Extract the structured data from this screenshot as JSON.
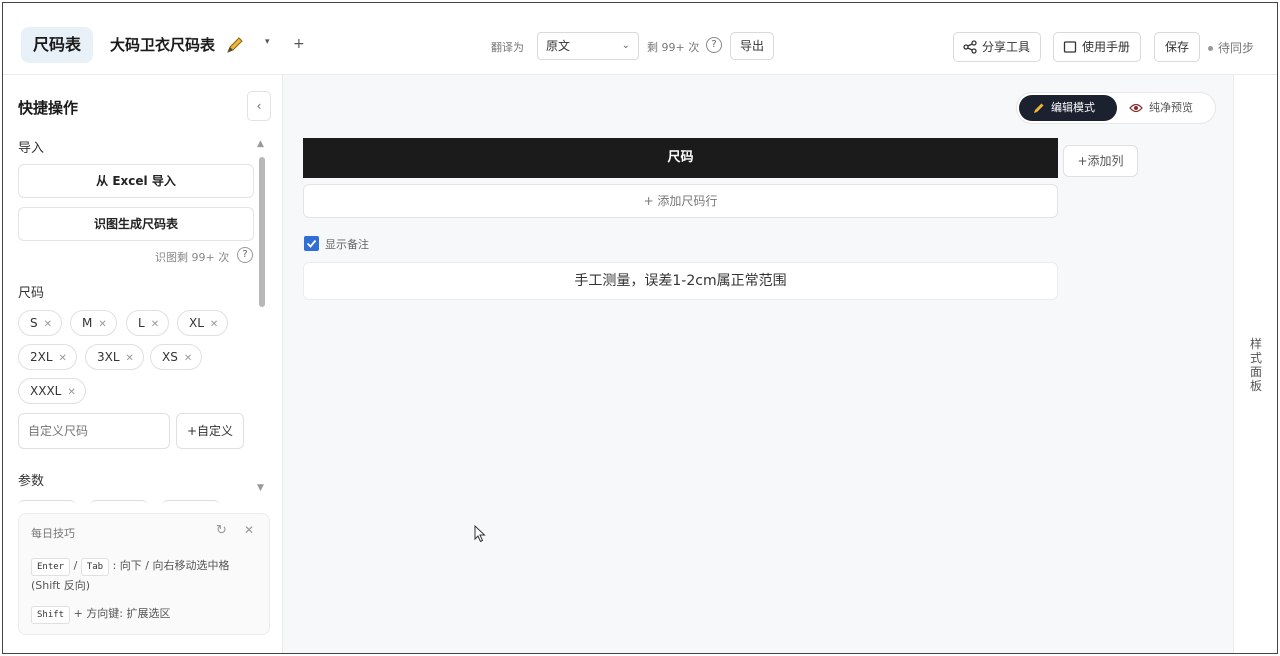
{
  "app": {
    "logo_label": "尺码表",
    "document_title": "大码卫衣尺码表"
  },
  "toolbar": {
    "translate_label": "翻译为",
    "translate_value": "原文",
    "remaining_label": "剩 99+ 次",
    "help_symbol": "?",
    "export_label": "导出",
    "share_label": "分享工具",
    "manual_label": "使用手册",
    "save_label": "保存",
    "sync_status": "待同步",
    "add_tab_symbol": "+",
    "dropdown_symbol": "▾"
  },
  "sidebar": {
    "title": "快捷操作",
    "collapse_symbol": "‹",
    "import_section": "导入",
    "import_excel": "从 Excel 导入",
    "recognize_image": "识图生成尺码表",
    "recognize_remaining": "识图剩 99+ 次",
    "size_section": "尺码",
    "sizes": [
      "S",
      "M",
      "L",
      "XL",
      "2XL",
      "3XL",
      "XS",
      "XXXL"
    ],
    "custom_placeholder": "自定义尺码",
    "custom_button": "+自定义",
    "params_section": "参数"
  },
  "tip": {
    "title": "每日技巧",
    "key_enter": "Enter",
    "separator": "/",
    "key_tab": "Tab",
    "line1_text": ": 向下 / 向右移动选中格",
    "line1_sub": "(Shift 反向)",
    "key_shift": "Shift",
    "line2_text": "+ 方向键: 扩展选区"
  },
  "editor": {
    "mode_edit": "编辑模式",
    "mode_preview": "纯净预览",
    "column_header": "尺码",
    "add_column": "+添加列",
    "add_row": "+ 添加尺码行",
    "show_notes_label": "显示备注",
    "show_notes_checked": true,
    "note_text": "手工测量，误差1-2cm属正常范围",
    "style_panel_label": "样式面板"
  },
  "icons": {
    "accent": "#2f6fd6",
    "dark_header": "#1b1b1b",
    "mode_active_bg": "#1c2130",
    "pencil_color": "#e0a020"
  }
}
